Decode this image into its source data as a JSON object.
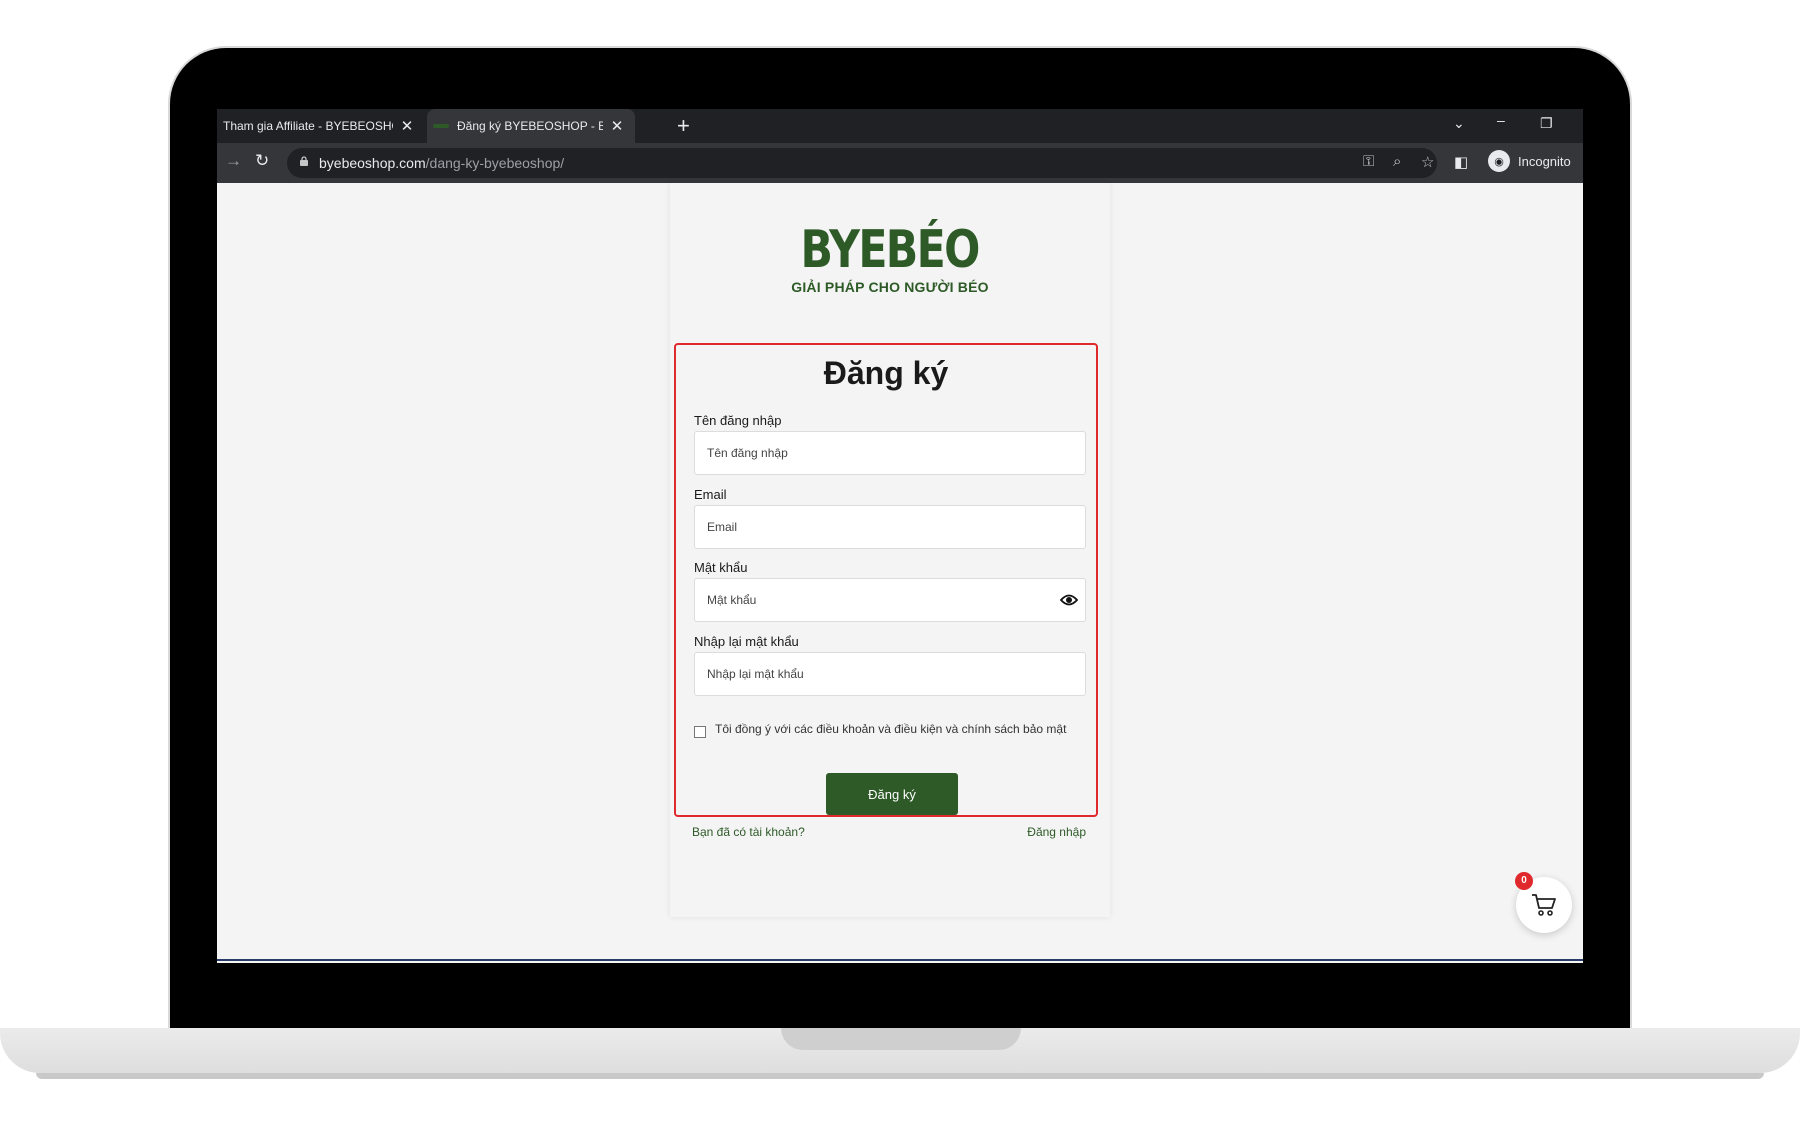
{
  "browser": {
    "tabs": [
      {
        "title": "Tham gia Affiliate - BYEBEOSHOP",
        "close": "✕"
      },
      {
        "title": "Đăng ký BYEBEOSHOP - BYEBEOSHOP",
        "close": "✕"
      }
    ],
    "new_tab": "+",
    "url_domain": "byebeoshop.com",
    "url_path": "/dang-ky-byebeoshop/",
    "profile_label": "Incognito"
  },
  "logo": {
    "brand": "BYEBÉO",
    "tagline": "GIẢI PHÁP CHO NGƯỜI BÉO",
    "brand_color": "#2d5a27"
  },
  "form": {
    "title": "Đăng ký",
    "username": {
      "label": "Tên đăng nhập",
      "placeholder": "Tên đăng nhập"
    },
    "email": {
      "label": "Email",
      "placeholder": "Email"
    },
    "password": {
      "label": "Mật khẩu",
      "placeholder": "Mật khẩu"
    },
    "confirm_password": {
      "label": "Nhập lại mật khẩu",
      "placeholder": "Nhập lại mật khẩu"
    },
    "agree_text": "Tôi đồng ý với các điều khoản và điều kiện và chính sách bảo mật",
    "submit_label": "Đăng ký",
    "highlight_color": "#e0292c"
  },
  "footer": {
    "have_account": "Bạn đã có tài khoản?",
    "login_link": "Đăng nhập"
  },
  "cart": {
    "count": "0"
  }
}
